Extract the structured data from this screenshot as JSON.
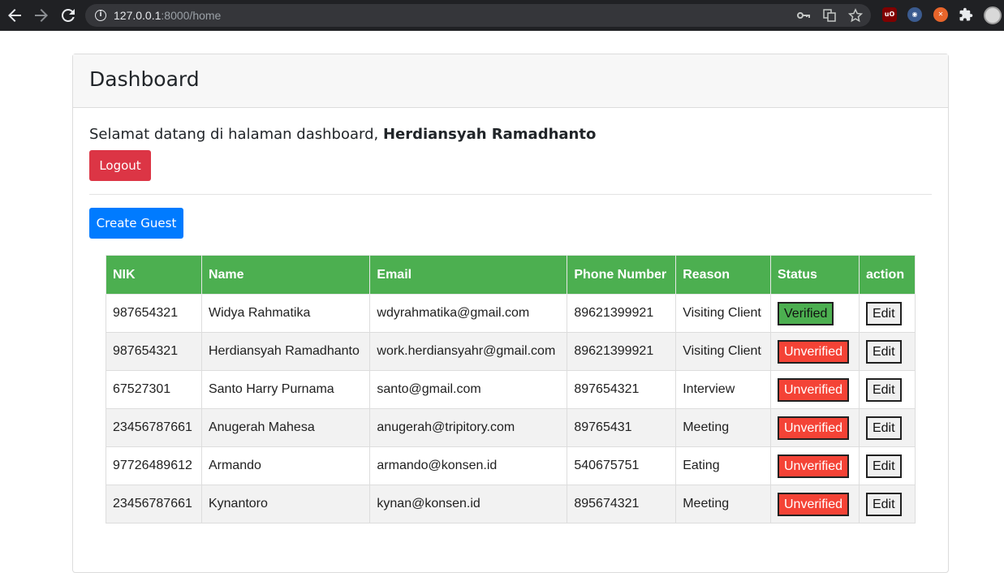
{
  "browser": {
    "url_host": "127.0.0.1",
    "url_path": ":8000/home",
    "back_icon": "arrow-left",
    "forward_icon": "arrow-right",
    "reload_icon": "reload",
    "info_icon": "i"
  },
  "header": {
    "title": "Dashboard"
  },
  "welcome": {
    "prefix": "Selamat datang di halaman dashboard, ",
    "user_name": "Herdiansyah Ramadhanto"
  },
  "buttons": {
    "logout": "Logout",
    "create_guest": "Create Guest"
  },
  "table": {
    "columns": [
      "NIK",
      "Name",
      "Email",
      "Phone Number",
      "Reason",
      "Status",
      "action"
    ],
    "rows": [
      {
        "nik": "987654321",
        "name": "Widya Rahmatika",
        "email": "wdyrahmatika@gmail.com",
        "phone": "89621399921",
        "reason": "Visiting Client",
        "status": "Verified",
        "action": "Edit"
      },
      {
        "nik": "987654321",
        "name": "Herdiansyah Ramadhanto",
        "email": "work.herdiansyahr@gmail.com",
        "phone": "89621399921",
        "reason": "Visiting Client",
        "status": "Unverified",
        "action": "Edit"
      },
      {
        "nik": "67527301",
        "name": "Santo Harry Purnama",
        "email": "santo@gmail.com",
        "phone": "897654321",
        "reason": "Interview",
        "status": "Unverified",
        "action": "Edit"
      },
      {
        "nik": "23456787661",
        "name": "Anugerah Mahesa",
        "email": "anugerah@tripitory.com",
        "phone": "89765431",
        "reason": "Meeting",
        "status": "Unverified",
        "action": "Edit"
      },
      {
        "nik": "97726489612",
        "name": "Armando",
        "email": "armando@konsen.id",
        "phone": "540675751",
        "reason": "Eating",
        "status": "Unverified",
        "action": "Edit"
      },
      {
        "nik": "23456787661",
        "name": "Kynantoro",
        "email": "kynan@konsen.id",
        "phone": "895674321",
        "reason": "Meeting",
        "status": "Unverified",
        "action": "Edit"
      }
    ]
  },
  "colors": {
    "header_green": "#4caf50",
    "verified": "#4caf50",
    "unverified": "#f44336",
    "logout": "#dc3545",
    "create": "#007bff"
  }
}
